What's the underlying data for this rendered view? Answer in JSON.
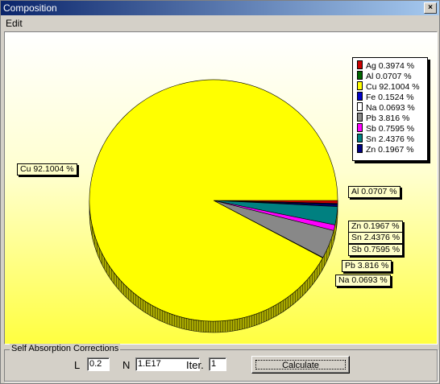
{
  "window": {
    "title": "Composition",
    "close_glyph": "×"
  },
  "menu": {
    "edit": "Edit"
  },
  "chart_data": {
    "type": "pie",
    "legend_position": "top-right",
    "series": [
      {
        "name": "Ag",
        "label": "Ag 0.3974 %",
        "value": 0.3974,
        "color": "#cc0000"
      },
      {
        "name": "Al",
        "label": "Al 0.0707 %",
        "value": 0.0707,
        "color": "#006600"
      },
      {
        "name": "Cu",
        "label": "Cu 92.1004 %",
        "value": 92.1004,
        "color": "#ffff00"
      },
      {
        "name": "Fe",
        "label": "Fe 0.1524 %",
        "value": 0.1524,
        "color": "#0000cc"
      },
      {
        "name": "Na",
        "label": "Na 0.0693 %",
        "value": 0.0693,
        "color": "#ffffff"
      },
      {
        "name": "Pb",
        "label": "Pb 3.816 %",
        "value": 3.816,
        "color": "#888888"
      },
      {
        "name": "Sb",
        "label": "Sb 0.7595 %",
        "value": 0.7595,
        "color": "#ff00ff"
      },
      {
        "name": "Sn",
        "label": "Sn 2.4376 %",
        "value": 2.4376,
        "color": "#008080"
      },
      {
        "name": "Zn",
        "label": "Zn 0.1967 %",
        "value": 0.1967,
        "color": "#000080"
      }
    ],
    "slice_labels": [
      "Cu 92.1004 %",
      "Al 0.0707 %",
      "Zn 0.1967 %",
      "Sn 2.4376 %",
      "Sb 0.7595 %",
      "Pb 3.816 %",
      "Na 0.0693 %"
    ]
  },
  "corrections": {
    "group_title": "Self Absorption Corrections",
    "l_label": "L",
    "l_value": "0.2",
    "n_label": "N",
    "n_value": "1.E17",
    "iter_label": "Iter.",
    "iter_value": "1",
    "calculate": "Calculate"
  }
}
